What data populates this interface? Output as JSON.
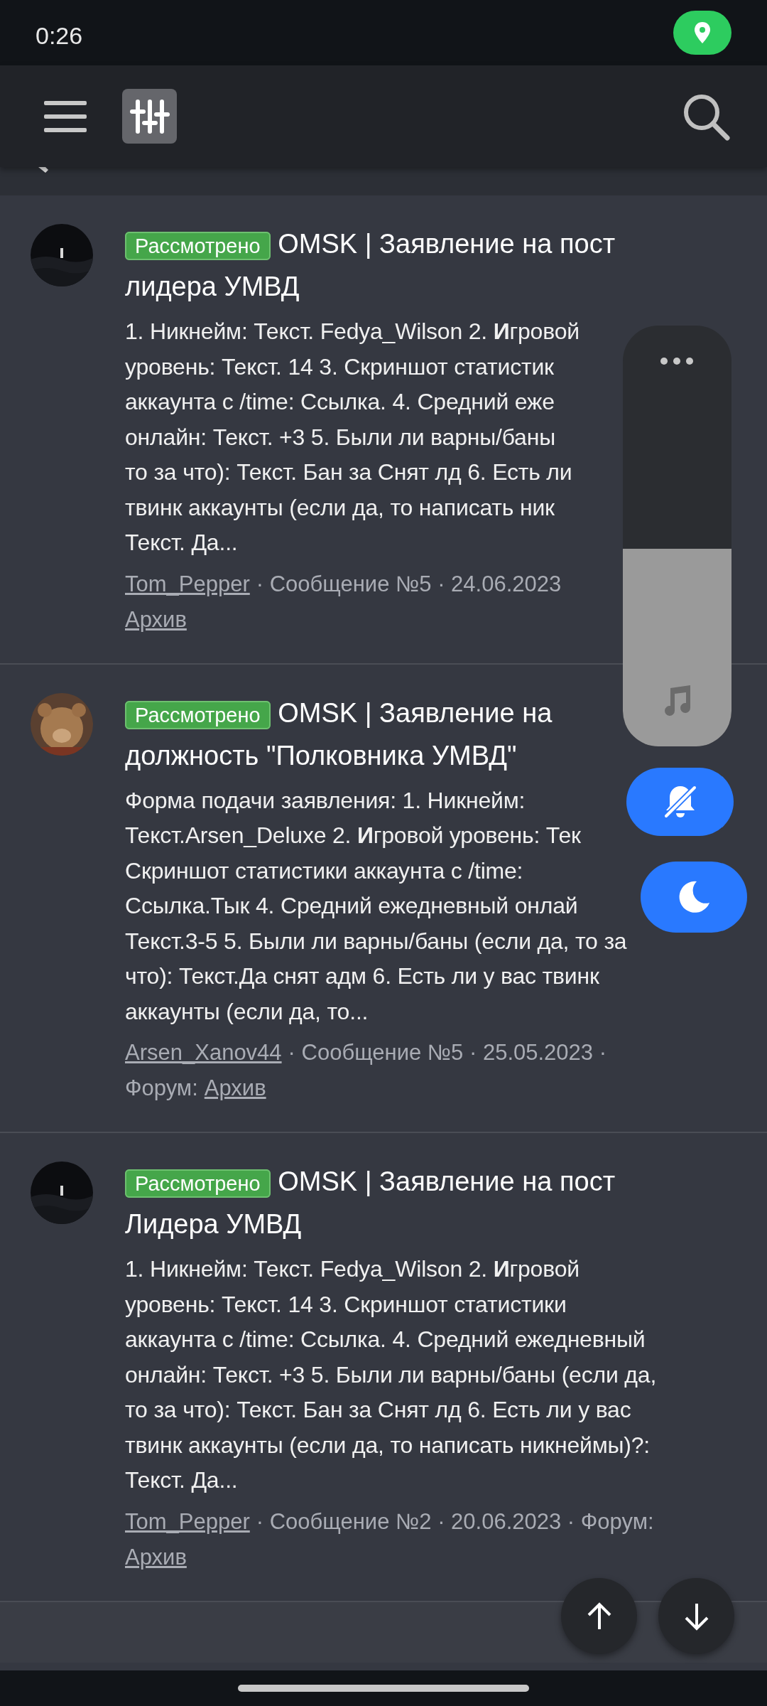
{
  "status_bar": {
    "time": "0:26"
  },
  "posts": [
    {
      "badge": "Рассмотрено",
      "title": "OMSK | Заявление на пост лидера УМВД",
      "body_lines": [
        "1. Никнейм: Текст. Fedya_Wilson 2. **И**гровой",
        "уровень: Текст. 14 3. Скриншот статистик",
        "аккаунта с /time: Ссылка. 4. Средний еже",
        "онлайн: Текст. +3 5. Были ли варны/баны",
        "то за что): Текст. Бан за Снят лд 6. Есть ли",
        "твинк аккаунты (если да, то написать ник",
        "Текст. Да..."
      ],
      "meta": [
        {
          "author": "Tom_Pepper",
          "info": "· Сообщение №5 · 24.06.2023"
        },
        {
          "forum": "Архив"
        }
      ]
    },
    {
      "badge": "Рассмотрено",
      "title": "OMSK | Заявление на должность \"Полковника УМВД\"",
      "body_lines": [
        "Форма подачи заявления: 1. Никнейм:",
        "Текст.Arsen_Deluxe 2. **И**гровой уровень: Тек",
        "Скриншот статистики аккаунта с /time:",
        "Ссылка.Тык 4. Средний ежедневный онлай",
        "Текст.3-5 5. Были ли варны/баны (если да, то за",
        "что): Текст.Да снят адм 6. Есть ли у вас твинк",
        "аккаунты (если да, то..."
      ],
      "meta": [
        {
          "author": "Arsen_Xanov44",
          "info": "· Сообщение №5 · 25.05.2023 ·"
        },
        {
          "forum_label": "Форум:",
          "forum": "Архив"
        }
      ]
    },
    {
      "badge": "Рассмотрено",
      "title": "OMSK | Заявление на пост Лидера УМВД",
      "body_lines": [
        "1. Никнейм: Текст. Fedya_Wilson 2. **И**гровой",
        "уровень: Текст. 14 3. Скриншот статистики",
        "аккаунта с /time: Ссылка. 4. Средний ежедневный",
        "онлайн: Текст. +3 5. Были ли варны/баны (если да,",
        "то за что): Текст. Бан за Снят лд 6. Есть ли у вас",
        "твинк аккаунты (если да, то написать никнеймы)?:",
        "Текст. Да..."
      ],
      "meta": [
        {
          "author": "Tom_Pepper",
          "info": "· Сообщение №2 · 20.06.2023 · Форум:"
        },
        {
          "forum": "Архив"
        }
      ]
    }
  ],
  "volume_panel": {
    "level": 0.47
  }
}
